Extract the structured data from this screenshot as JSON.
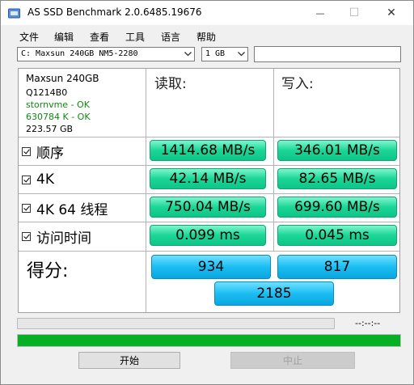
{
  "window": {
    "title": "AS SSD Benchmark 2.0.6485.19676",
    "controls": {
      "minimize": "—",
      "maximize": "☐",
      "close": "✕"
    }
  },
  "menu": [
    "文件",
    "编辑",
    "查看",
    "工具",
    "语言",
    "帮助"
  ],
  "toolbar": {
    "drive_select": "C: Maxsun 240GB NM5-2280",
    "size_select": "1 GB",
    "text_value": ""
  },
  "info": {
    "model": "Maxsun 240GB",
    "firmware": "Q1214B0",
    "driver": "stornvme - OK",
    "alignment": "630784 K - OK",
    "capacity": "223.57 GB"
  },
  "columns": {
    "read": "读取:",
    "write": "写入:"
  },
  "rows": [
    {
      "label": "顺序",
      "read": "1414.68 MB/s",
      "write": "346.01 MB/s"
    },
    {
      "label": "4K",
      "read": "42.14 MB/s",
      "write": "82.65 MB/s"
    },
    {
      "label": "4K 64 线程",
      "read": "750.04 MB/s",
      "write": "699.60 MB/s"
    },
    {
      "label": "访问时间",
      "read": "0.099 ms",
      "write": "0.045 ms"
    }
  ],
  "score": {
    "label": "得分:",
    "read": "934",
    "write": "817",
    "total": "2185"
  },
  "progress": {
    "timer": "--:--:--",
    "current_fraction": 0,
    "total_fraction": 1
  },
  "buttons": {
    "start": "开始",
    "abort": "中止"
  },
  "colors": {
    "result_green": "#1ad697",
    "score_blue": "#1bbdf2",
    "progress_green": "#06b025"
  }
}
